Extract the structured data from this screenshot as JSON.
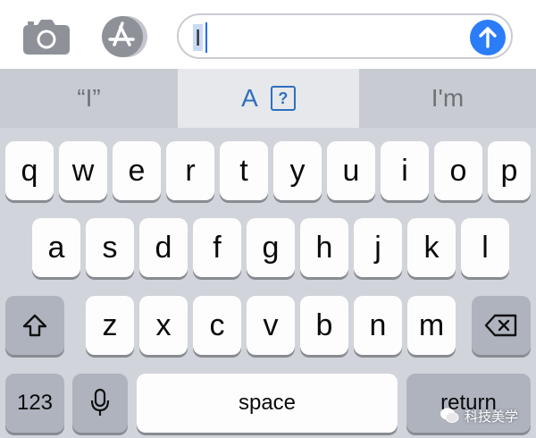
{
  "compose": {
    "text": "I",
    "icons": {
      "camera": "camera-icon",
      "app_store": "app-store-icon",
      "send": "arrow-up-icon"
    }
  },
  "predictions": {
    "left": "“I”",
    "middle": "A",
    "middle_badge": "?",
    "right": "I'm"
  },
  "keyboard": {
    "row1": [
      "q",
      "w",
      "e",
      "r",
      "t",
      "y",
      "u",
      "i",
      "o",
      "p"
    ],
    "row2": [
      "a",
      "s",
      "d",
      "f",
      "g",
      "h",
      "j",
      "k",
      "l"
    ],
    "row3": [
      "z",
      "x",
      "c",
      "v",
      "b",
      "n",
      "m"
    ],
    "numbers_label": "123",
    "space_label": "space",
    "return_label": "return",
    "icons": {
      "shift": "shift-icon",
      "delete": "backspace-icon",
      "dictation": "microphone-icon"
    }
  },
  "watermark": {
    "text": "科技美学"
  },
  "colors": {
    "accent": "#2b7cf7",
    "key_bg": "#fdfdfd",
    "keyboard_bg": "#d1d4da",
    "dark_key": "#aeb3be"
  }
}
